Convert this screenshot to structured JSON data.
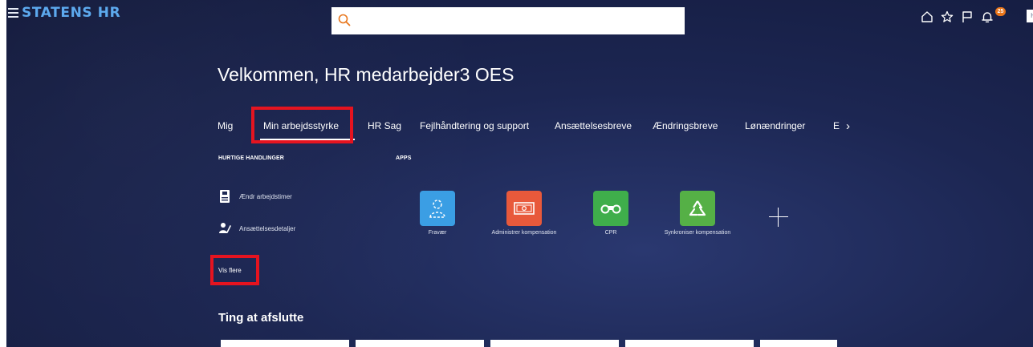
{
  "header": {
    "brand": "STATENS HR",
    "search": {
      "placeholder": "",
      "value": ""
    },
    "icons": [
      "home-icon",
      "star-icon",
      "flag-icon",
      "notifications-icon"
    ],
    "notification_count": "25",
    "avatar_initial": "H"
  },
  "greeting": "Velkommen, HR medarbejder3 OES",
  "tabs": [
    {
      "label": "Mig",
      "active": false
    },
    {
      "label": "Min arbejdsstyrke",
      "active": true
    },
    {
      "label": "HR Sag",
      "active": false
    },
    {
      "label": "Fejlhåndtering og support",
      "active": false
    },
    {
      "label": "Ansættelsesbreve",
      "active": false
    },
    {
      "label": "Ændringsbreve",
      "active": false
    },
    {
      "label": "Lønændringer",
      "active": false
    },
    {
      "label": "E",
      "active": false
    }
  ],
  "quick_actions": {
    "heading": "HURTIGE HANDLINGER",
    "items": [
      {
        "label": "Ændr arbejdstimer",
        "icon": "timesheet-icon"
      },
      {
        "label": "Ansættelsesdetaljer",
        "icon": "employment-details-icon"
      }
    ],
    "show_more": "Vis flere"
  },
  "apps": {
    "heading": "APPS",
    "items": [
      {
        "label": "Fravær",
        "icon": "person-absence-icon",
        "color": "#3a9ee4"
      },
      {
        "label": "Administrer kompensation",
        "icon": "money-icon",
        "color": "#e8593b"
      },
      {
        "label": "CPR",
        "icon": "binoculars-icon",
        "color": "#3fae4b"
      },
      {
        "label": "Synkroniser kompensation",
        "icon": "recycle-icon",
        "color": "#55b046"
      }
    ],
    "add_icon": "plus-icon"
  },
  "things_to_finish": {
    "title": "Ting at afslutte"
  },
  "colors": {
    "highlight": "#e5111d",
    "brand": "#5aa8ee",
    "badge": "#e8751a"
  }
}
